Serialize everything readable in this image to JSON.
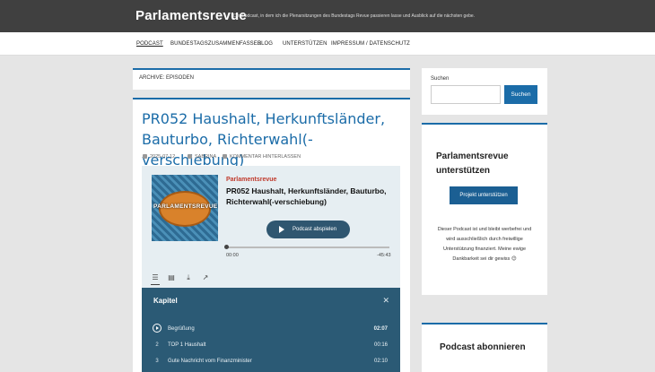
{
  "header": {
    "title": "Parlamentsrevue",
    "tagline": "Der Podcast, in dem ich die Plenarsitzungen des Bundestags Revue passieren lasse und Ausblick auf die nächsten gebe."
  },
  "nav": {
    "items": [
      {
        "label": "Podcast"
      },
      {
        "label": "Bundestagszusammenfasser"
      },
      {
        "label": "Blog"
      },
      {
        "label": "Unterstützen"
      },
      {
        "label": "Impressum / Datenschutz"
      }
    ]
  },
  "archive": {
    "title": "ARCHIVE: EPISODEN"
  },
  "post": {
    "title": "PR052 Haushalt, Herkunftsländer, Bauturbo, Richterwahl(-verschiebung)",
    "date": "2025-07-12",
    "author": "Sabrina",
    "comment_link": "Kommentar hinterlassen"
  },
  "player": {
    "cover_text": "PARLAMENTSREVUE",
    "show": "Parlamentsrevue",
    "episode_title": "PR052 Haushalt, Herkunftsländer, Bauturbo, Richterwahl(-verschiebung)",
    "play_label": "Podcast abspielen",
    "time_current": "00:00",
    "time_remaining": "-45:43",
    "progress": 0,
    "tools": {
      "chapters_icon": "list-icon",
      "transcript_icon": "document-icon",
      "download_icon": "download-icon",
      "share_icon": "share-icon"
    },
    "chapters": {
      "heading": "Kapitel",
      "items": [
        {
          "num": "",
          "title": "Begrüßung",
          "duration": "02:07"
        },
        {
          "num": "2",
          "title": "TOP 1 Haushalt",
          "duration": "00:16"
        },
        {
          "num": "3",
          "title": "Gute Nachricht vom Finanzminister",
          "duration": "02:10"
        }
      ]
    }
  },
  "sidebar": {
    "search": {
      "label": "Suchen",
      "button": "Suchen",
      "placeholder": ""
    },
    "support": {
      "heading": "Parlamentsrevue unterstützen",
      "button": "Projekt unterstützen",
      "text": "Dieser Podcast ist und bleibt werbefrei und wird ausschließlich durch freiwillige Unterstützung finanziert. Meine ewige Dankbarkeit sei dir gewiss 😊"
    },
    "subscribe": {
      "heading": "Podcast abonnieren"
    }
  },
  "colors": {
    "topbar": "#404040",
    "accent": "#1b6ca8",
    "player_dark": "#2b5a75",
    "show_red": "#c0392b"
  }
}
